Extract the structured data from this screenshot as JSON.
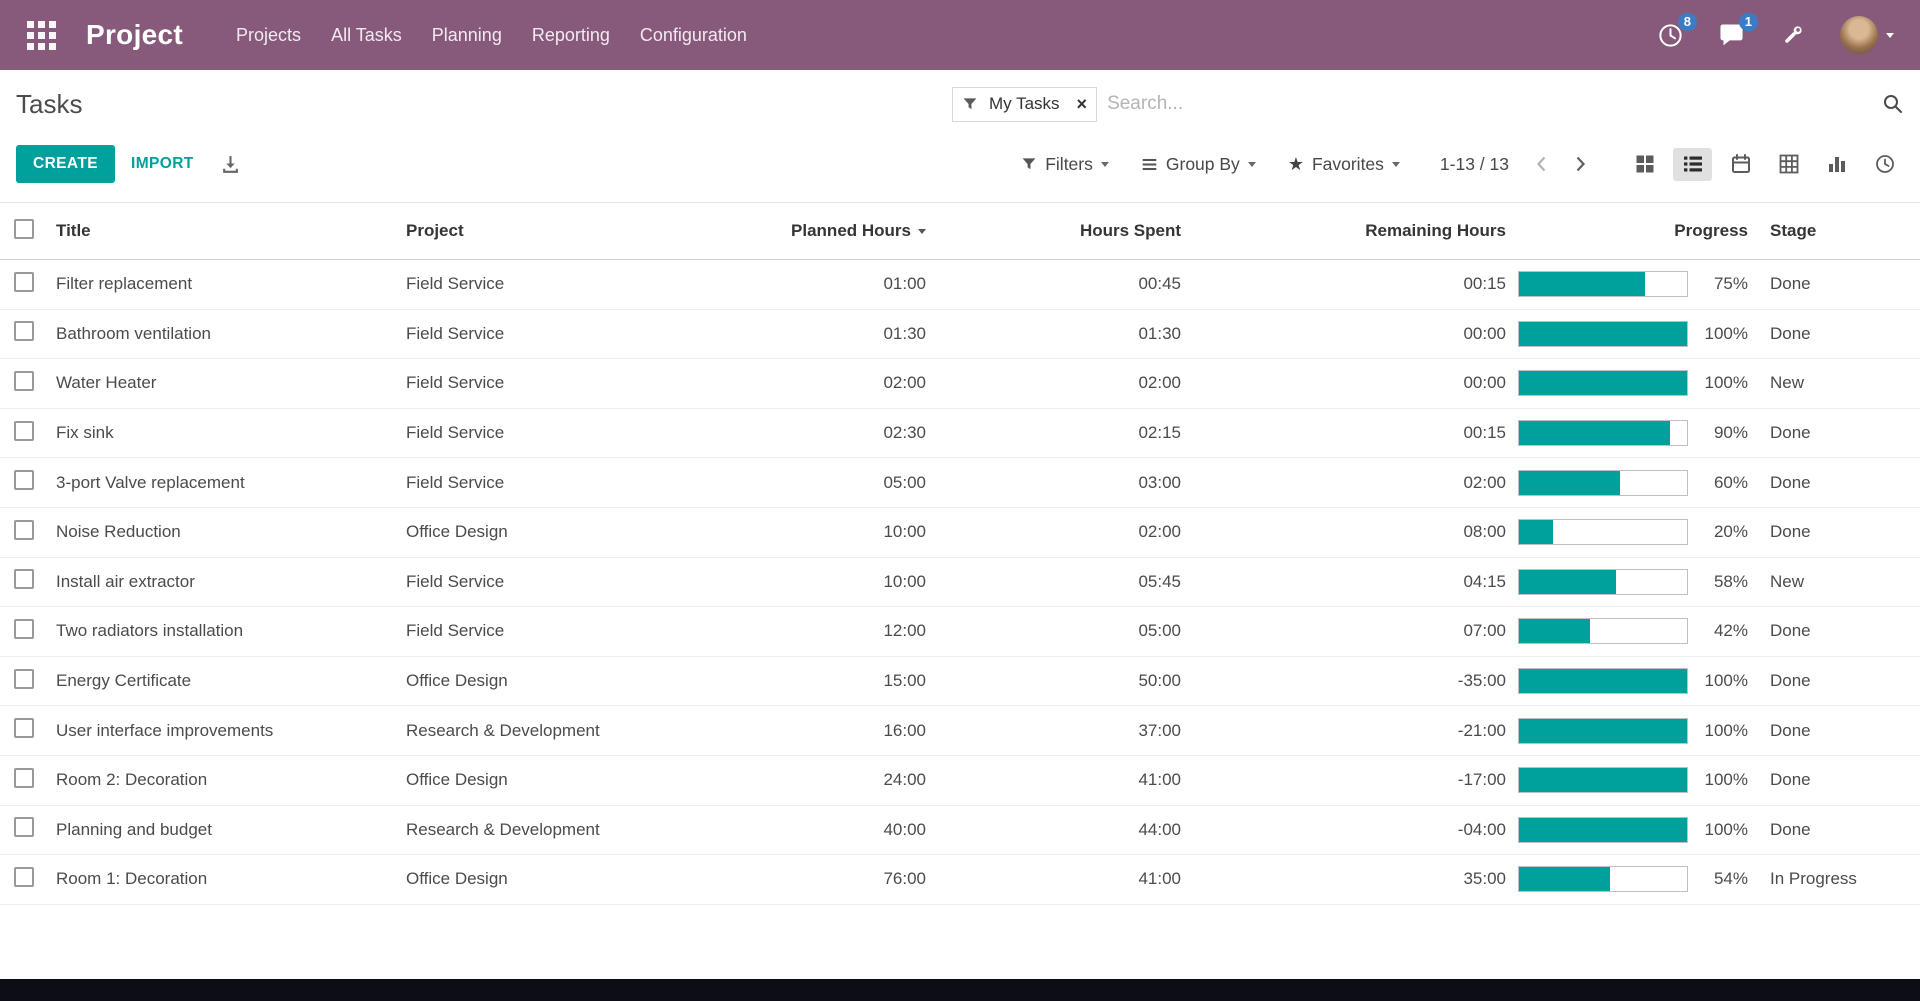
{
  "colors": {
    "accent": "#00a09d",
    "navbar_bg": "#875a7b",
    "badge_bg": "#3b7cc4"
  },
  "navbar": {
    "app_title": "Project",
    "menu": [
      "Projects",
      "All Tasks",
      "Planning",
      "Reporting",
      "Configuration"
    ],
    "activity_badge": "8",
    "message_badge": "1"
  },
  "control_panel": {
    "breadcrumb": "Tasks",
    "search": {
      "facet_label": "My Tasks",
      "facet_remove": "×",
      "placeholder": "Search..."
    },
    "buttons": {
      "create": "CREATE",
      "import": "IMPORT"
    },
    "dropdowns": {
      "filters": "Filters",
      "group_by": "Group By",
      "favorites": "Favorites"
    },
    "pager": {
      "range": "1-13 / 13"
    },
    "view_switcher": {
      "active_view": "list",
      "views": [
        "kanban",
        "list",
        "calendar",
        "pivot",
        "graph",
        "activity"
      ]
    }
  },
  "table": {
    "headers": {
      "title": "Title",
      "project": "Project",
      "planned": "Planned Hours",
      "spent": "Hours Spent",
      "remaining": "Remaining Hours",
      "progress": "Progress",
      "stage": "Stage"
    },
    "rows": [
      {
        "title": "Filter replacement",
        "project": "Field Service",
        "planned_hours": "01:00",
        "hours_spent": "00:45",
        "remaining_hours": "00:15",
        "progress_pct": 75,
        "progress_label": "75%",
        "stage": "Done"
      },
      {
        "title": "Bathroom ventilation",
        "project": "Field Service",
        "planned_hours": "01:30",
        "hours_spent": "01:30",
        "remaining_hours": "00:00",
        "progress_pct": 100,
        "progress_label": "100%",
        "stage": "Done"
      },
      {
        "title": "Water Heater",
        "project": "Field Service",
        "planned_hours": "02:00",
        "hours_spent": "02:00",
        "remaining_hours": "00:00",
        "progress_pct": 100,
        "progress_label": "100%",
        "stage": "New"
      },
      {
        "title": "Fix sink",
        "project": "Field Service",
        "planned_hours": "02:30",
        "hours_spent": "02:15",
        "remaining_hours": "00:15",
        "progress_pct": 90,
        "progress_label": "90%",
        "stage": "Done"
      },
      {
        "title": "3-port Valve replacement",
        "project": "Field Service",
        "planned_hours": "05:00",
        "hours_spent": "03:00",
        "remaining_hours": "02:00",
        "progress_pct": 60,
        "progress_label": "60%",
        "stage": "Done"
      },
      {
        "title": "Noise Reduction",
        "project": "Office Design",
        "planned_hours": "10:00",
        "hours_spent": "02:00",
        "remaining_hours": "08:00",
        "progress_pct": 20,
        "progress_label": "20%",
        "stage": "Done"
      },
      {
        "title": "Install air extractor",
        "project": "Field Service",
        "planned_hours": "10:00",
        "hours_spent": "05:45",
        "remaining_hours": "04:15",
        "progress_pct": 58,
        "progress_label": "58%",
        "stage": "New"
      },
      {
        "title": "Two radiators installation",
        "project": "Field Service",
        "planned_hours": "12:00",
        "hours_spent": "05:00",
        "remaining_hours": "07:00",
        "progress_pct": 42,
        "progress_label": "42%",
        "stage": "Done"
      },
      {
        "title": "Energy Certificate",
        "project": "Office Design",
        "planned_hours": "15:00",
        "hours_spent": "50:00",
        "remaining_hours": "-35:00",
        "progress_pct": 100,
        "progress_label": "100%",
        "stage": "Done"
      },
      {
        "title": "User interface improvements",
        "project": "Research & Development",
        "planned_hours": "16:00",
        "hours_spent": "37:00",
        "remaining_hours": "-21:00",
        "progress_pct": 100,
        "progress_label": "100%",
        "stage": "Done"
      },
      {
        "title": "Room 2: Decoration",
        "project": "Office Design",
        "planned_hours": "24:00",
        "hours_spent": "41:00",
        "remaining_hours": "-17:00",
        "progress_pct": 100,
        "progress_label": "100%",
        "stage": "Done"
      },
      {
        "title": "Planning and budget",
        "project": "Research & Development",
        "planned_hours": "40:00",
        "hours_spent": "44:00",
        "remaining_hours": "-04:00",
        "progress_pct": 100,
        "progress_label": "100%",
        "stage": "Done"
      },
      {
        "title": "Room 1: Decoration",
        "project": "Office Design",
        "planned_hours": "76:00",
        "hours_spent": "41:00",
        "remaining_hours": "35:00",
        "progress_pct": 54,
        "progress_label": "54%",
        "stage": "In Progress"
      }
    ]
  }
}
